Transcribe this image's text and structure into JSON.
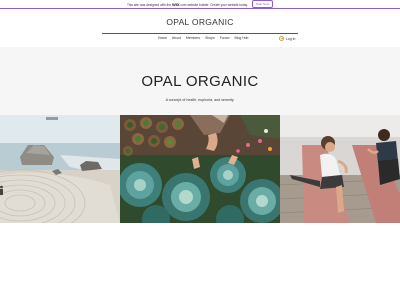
{
  "wix_banner": {
    "text_before": "This site was designed with the",
    "logo": "WIX",
    "text_after": ".com website builder. Create your website today.",
    "cta": "Start Now"
  },
  "header": {
    "site_title": "OPAL ORGANIC",
    "nav": [
      "Home",
      "About",
      "Members",
      "Shops",
      "Forum",
      "Blog Hub"
    ],
    "login_label": "Log In"
  },
  "hero": {
    "title": "OPAL ORGANIC",
    "tagline": "A concept of health, euphoria, and serenity."
  },
  "images": [
    {
      "subject": "zen sand garden with rocks and sea"
    },
    {
      "subject": "hands harvesting cabbage and plants"
    },
    {
      "subject": "women stretching on yoga mats"
    }
  ],
  "colors": {
    "wix_accent": "#8a5cd6",
    "login_accent": "#c8a24a",
    "hero_bg": "#f6f6f6"
  }
}
